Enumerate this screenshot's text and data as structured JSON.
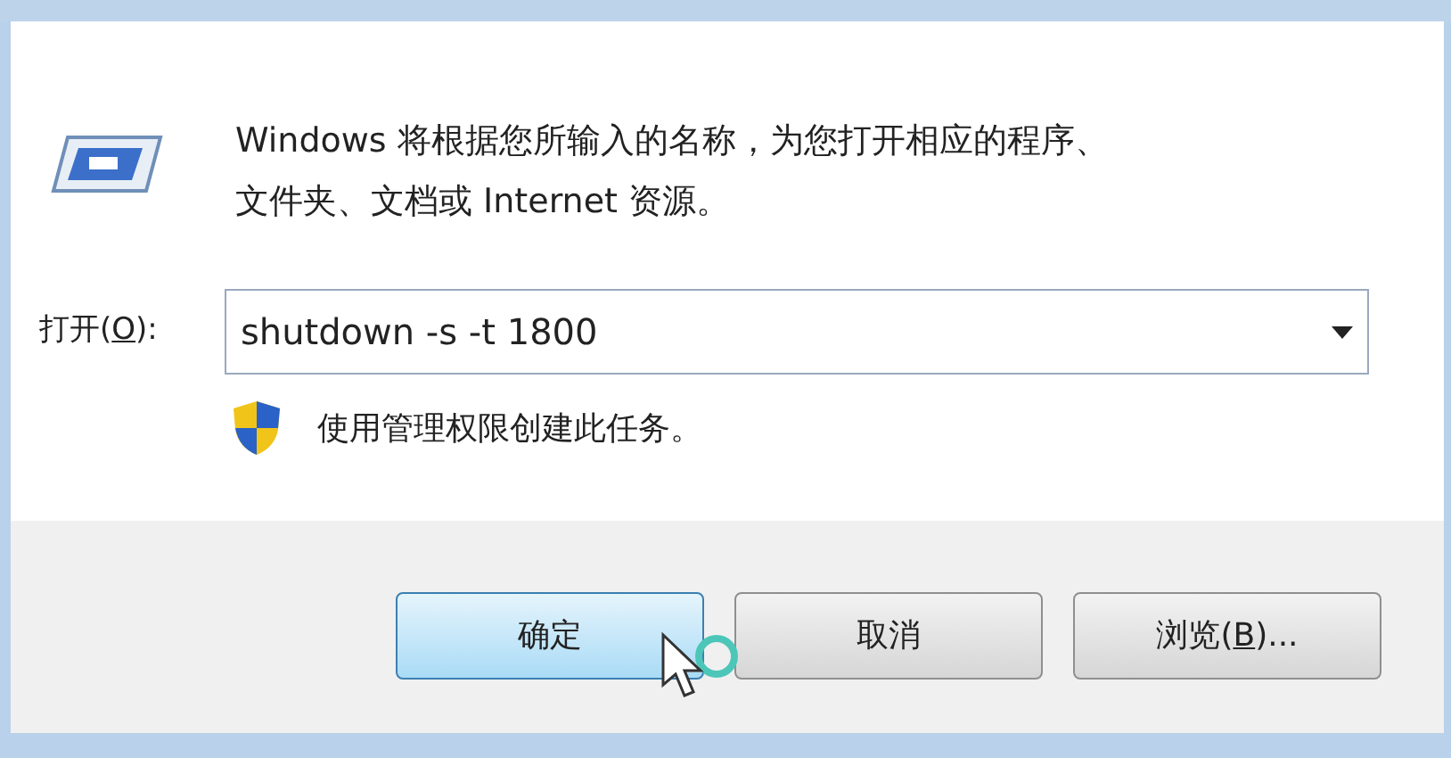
{
  "description": {
    "lines": [
      "Windows 将根据您所输入的名称，为您打开相应的程序、",
      "文件夹、文档或 Internet 资源。"
    ]
  },
  "open_field": {
    "label": [
      {
        "text": "打开(",
        "underlined": false
      },
      {
        "text": "O",
        "underlined": true
      },
      {
        "text": "):",
        "underlined": false
      }
    ],
    "value": "shutdown -s -t 1800"
  },
  "admin_note": "使用管理权限创建此任务。",
  "buttons": [
    {
      "label": [
        {
          "text": "确定",
          "underlined": false
        }
      ],
      "default": true
    },
    {
      "label": [
        {
          "text": "取消",
          "underlined": false
        }
      ],
      "default": false
    },
    {
      "label": [
        {
          "text": "浏览(",
          "underlined": false
        },
        {
          "text": "B",
          "underlined": true
        },
        {
          "text": ")...",
          "underlined": false
        }
      ],
      "default": false
    }
  ]
}
